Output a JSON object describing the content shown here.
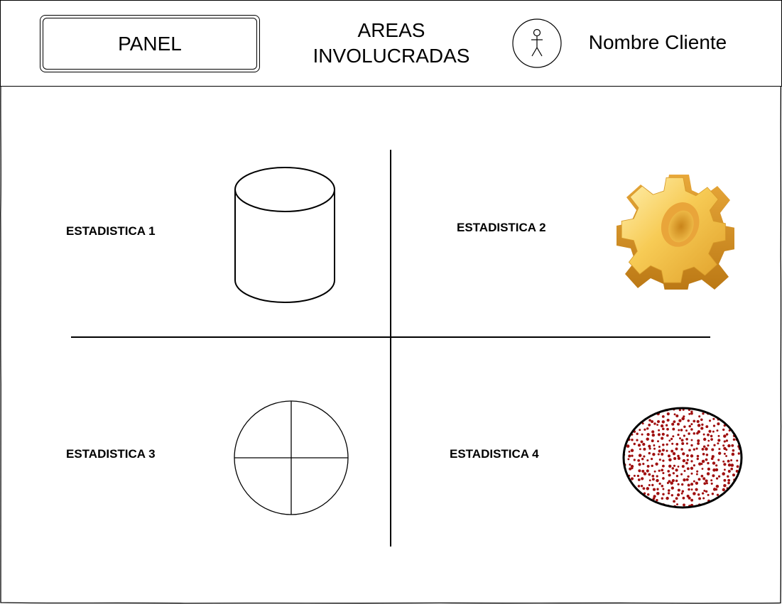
{
  "header": {
    "panel_label": "PANEL",
    "areas_label": "AREAS\nINVOLUCRADAS",
    "client_name": "Nombre Cliente",
    "avatar_icon": "user-icon"
  },
  "stats": [
    {
      "label": "ESTADISTICA 1",
      "icon": "database-icon"
    },
    {
      "label": "ESTADISTICA 2",
      "icon": "gear-icon"
    },
    {
      "label": "ESTADISTICA 3",
      "icon": "pie-chart-icon"
    },
    {
      "label": "ESTADISTICA 4",
      "icon": "dotted-circle-icon"
    }
  ],
  "colors": {
    "line": "#000000",
    "gear_light": "#FFE08A",
    "gear_mid": "#F5C242",
    "gear_dark": "#D9951E",
    "dots": "#A01010"
  }
}
